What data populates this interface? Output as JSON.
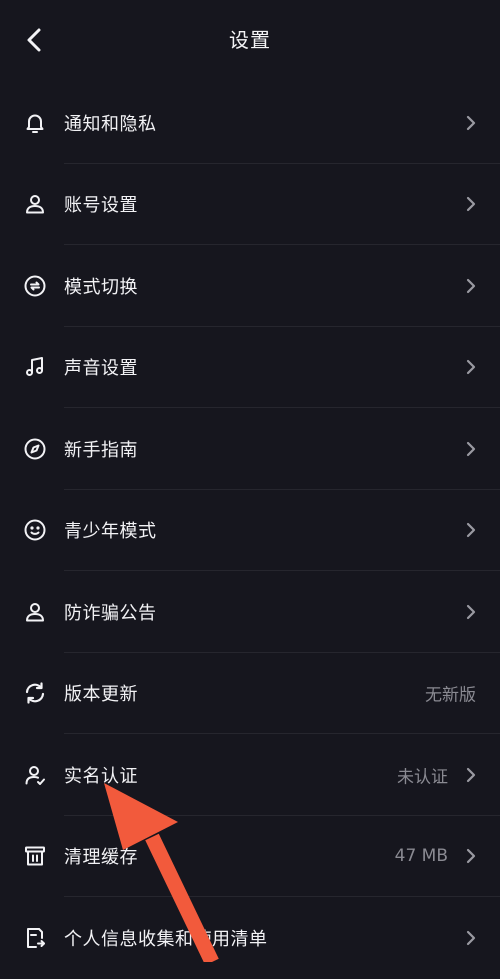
{
  "header": {
    "title": "设置"
  },
  "rows": [
    {
      "label": "通知和隐私",
      "value": "",
      "icon": "bell-icon"
    },
    {
      "label": "账号设置",
      "value": "",
      "icon": "user-icon"
    },
    {
      "label": "模式切换",
      "value": "",
      "icon": "switch-mode-icon"
    },
    {
      "label": "声音设置",
      "value": "",
      "icon": "music-note-icon"
    },
    {
      "label": "新手指南",
      "value": "",
      "icon": "compass-icon"
    },
    {
      "label": "青少年模式",
      "value": "",
      "icon": "smiley-icon"
    },
    {
      "label": "防诈骗公告",
      "value": "",
      "icon": "user-icon"
    },
    {
      "label": "版本更新",
      "value": "无新版",
      "icon": "refresh-icon"
    },
    {
      "label": "实名认证",
      "value": "未认证",
      "icon": "user-verified-icon"
    },
    {
      "label": "清理缓存",
      "value": "47 MB",
      "icon": "trash-box-icon"
    },
    {
      "label": "个人信息收集和使用清单",
      "value": "",
      "icon": "document-list-icon"
    }
  ],
  "colors": {
    "background": "#16161e",
    "text": "#f2f2f5",
    "secondary_text": "#8a8a92",
    "annotation_arrow": "#f25a3c"
  }
}
